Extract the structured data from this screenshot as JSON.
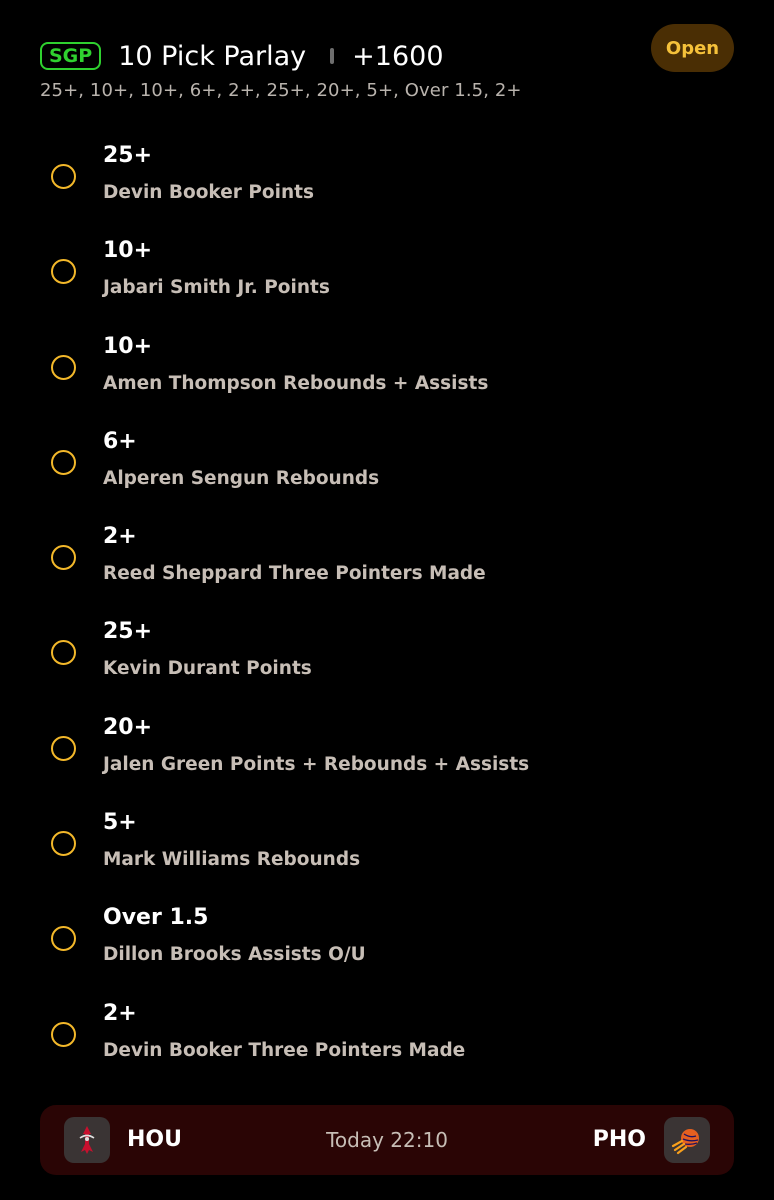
{
  "header": {
    "badge": "SGP",
    "title": "10 Pick Parlay",
    "odds": "+1600",
    "status": "Open",
    "summary": "25+, 10+, 10+, 6+, 2+, 25+, 20+, 5+, Over 1.5, 2+"
  },
  "legs": [
    {
      "line": "25+",
      "desc": "Devin Booker Points"
    },
    {
      "line": "10+",
      "desc": "Jabari Smith Jr. Points"
    },
    {
      "line": "10+",
      "desc": "Amen Thompson Rebounds + Assists"
    },
    {
      "line": "6+",
      "desc": "Alperen Sengun Rebounds"
    },
    {
      "line": "2+",
      "desc": "Reed Sheppard Three Pointers Made"
    },
    {
      "line": "25+",
      "desc": "Kevin Durant Points"
    },
    {
      "line": "20+",
      "desc": "Jalen Green Points + Rebounds + Assists"
    },
    {
      "line": "5+",
      "desc": "Mark Williams Rebounds"
    },
    {
      "line": "Over 1.5",
      "desc": "Dillon Brooks Assists O/U"
    },
    {
      "line": "2+",
      "desc": "Devin Booker Three Pointers Made"
    }
  ],
  "game": {
    "home_team": "HOU",
    "home_logo": "rockets-logo-icon",
    "away_team": "PHO",
    "away_logo": "suns-logo-icon",
    "time": "Today 22:10"
  },
  "colors": {
    "background": "#000000",
    "badge_green": "#2fd12f",
    "status_gold": "#f5c13a",
    "status_bg": "#4a2e04",
    "leg_circle": "#f3b82a",
    "game_bar_bg": "#2a0505"
  }
}
